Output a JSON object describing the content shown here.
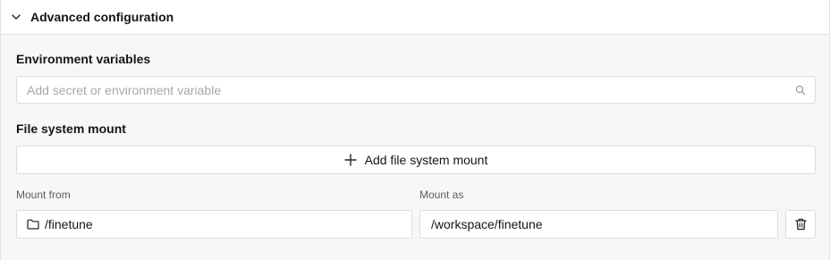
{
  "header": {
    "title": "Advanced configuration",
    "icon": "chevron-down-icon"
  },
  "env": {
    "label": "Environment variables",
    "placeholder": "Add secret or environment variable",
    "value": "",
    "icon": "search-icon"
  },
  "mount": {
    "label": "File system mount",
    "add_label": "Add file system mount",
    "add_icon": "plus-icon",
    "from_label": "Mount from",
    "from_value": "/finetune",
    "from_icon": "folder-icon",
    "as_label": "Mount as",
    "as_value": "/workspace/finetune",
    "delete_icon": "trash-icon"
  }
}
